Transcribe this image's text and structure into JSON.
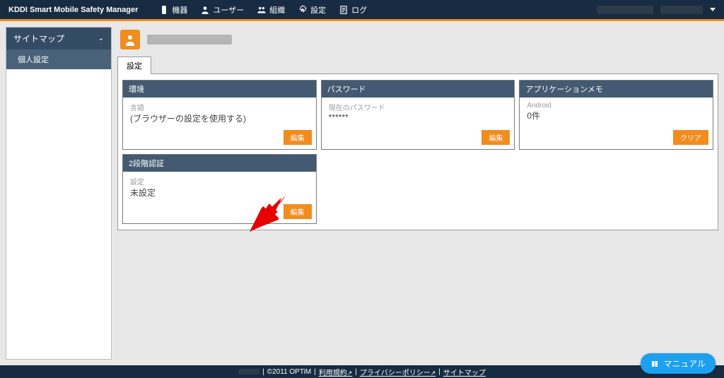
{
  "app": {
    "title": "KDDI Smart Mobile Safety Manager"
  },
  "nav": {
    "items": [
      {
        "label": "機器"
      },
      {
        "label": "ユーザー"
      },
      {
        "label": "組織"
      },
      {
        "label": "設定"
      },
      {
        "label": "ログ"
      }
    ]
  },
  "sidebar": {
    "title": "サイトマップ",
    "items": [
      {
        "label": "個人設定"
      }
    ]
  },
  "tabs": [
    {
      "label": "設定"
    }
  ],
  "cards": {
    "env": {
      "title": "環境",
      "label": "言語",
      "value": "(ブラウザーの設定を使用する)",
      "button": "編集"
    },
    "password": {
      "title": "パスワード",
      "label": "現在のパスワード",
      "value": "******",
      "button": "編集"
    },
    "appmemo": {
      "title": "アプリケーションメモ",
      "label": "Android",
      "value": "0件",
      "button": "クリア"
    },
    "mfa": {
      "title": "2段階認証",
      "label": "設定",
      "value": "未設定",
      "button": "編集"
    }
  },
  "footer": {
    "copyright": "©2011 OPTiM",
    "links": [
      {
        "label": "利用規約"
      },
      {
        "label": "プライバシーポリシー"
      },
      {
        "label": "サイトマップ"
      }
    ]
  },
  "manual": {
    "label": "マニュアル"
  }
}
